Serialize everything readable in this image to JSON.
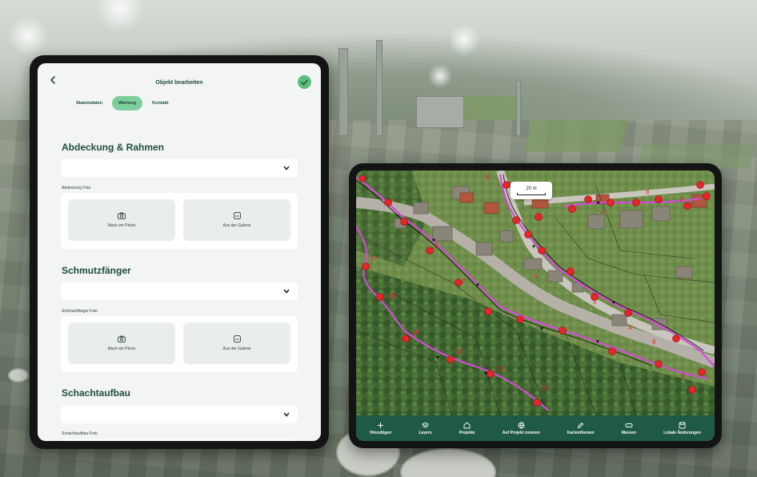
{
  "form_app": {
    "title": "Objekt bearbeiten",
    "tabs": [
      {
        "label": "Stammdaten",
        "active": false
      },
      {
        "label": "Wartung",
        "active": true
      },
      {
        "label": "Kontakt",
        "active": false
      }
    ],
    "sections": [
      {
        "title": "Abdeckung & Rahmen",
        "photo_label": "Abdeckung Foto"
      },
      {
        "title": "Schmutzfänger",
        "photo_label": "Schmutzfänger Foto"
      },
      {
        "title": "Schachtaufbau",
        "photo_label": "Schachtaufbau Foto"
      }
    ],
    "photo_buttons": {
      "camera": "Mach ein Photo",
      "gallery": "Aus der Galerie"
    },
    "colors": {
      "accent": "#5bbd7c",
      "tab_active": "#7ccf9a",
      "text_dark": "#1f4d3a"
    }
  },
  "map_app": {
    "scale_label": "20 m",
    "nav": [
      {
        "label": "Hinzufügen",
        "icon": "plus-icon"
      },
      {
        "label": "Layers",
        "icon": "layers-icon"
      },
      {
        "label": "Projekte",
        "icon": "home-icon"
      },
      {
        "label": "Auf Projekt zoomen",
        "icon": "globe-icon"
      },
      {
        "label": "Kartenthemen",
        "icon": "pen-icon"
      },
      {
        "label": "Messen",
        "icon": "ruler-icon"
      },
      {
        "label": "Lokale Änderungen",
        "icon": "save-icon"
      }
    ],
    "point_labels": [
      "6",
      "6",
      "7",
      "6",
      "5",
      "4",
      "9",
      "17",
      "18",
      "19",
      "20",
      "21",
      "22",
      "6",
      "5",
      "9",
      "8"
    ],
    "colors": {
      "bottom_bar": "#1f5a45",
      "route_line": "#d24bd6",
      "point": "#e5252a"
    }
  }
}
